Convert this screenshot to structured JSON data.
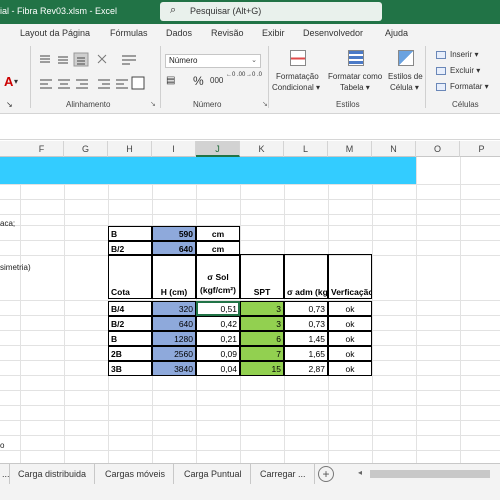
{
  "window": {
    "title": "ial - Fibra Rev03.xlsm  -  Excel"
  },
  "search": {
    "placeholder": "Pesquisar (Alt+G)"
  },
  "menu": [
    "Layout da Página",
    "Fórmulas",
    "Dados",
    "Revisão",
    "Exibir",
    "Desenvolvedor",
    "Ajuda"
  ],
  "ribbon": {
    "font_color_letter": "A",
    "font_color_arrow": "▾",
    "align_launcher": "↘",
    "number_format": "Número",
    "percent": "%",
    "thousands": "000",
    "decimals_inc": "←0 .00",
    "decimals_dec": "→0 .0",
    "conditional": [
      "Formatação",
      "Condicional ▾"
    ],
    "format_as_table": [
      "Formatar como",
      "Tabela ▾"
    ],
    "cell_styles": [
      "Estilos de",
      "Célula ▾"
    ],
    "insert": "Inserir ▾",
    "delete": "Excluir ▾",
    "format": "Formatar ▾",
    "groups": {
      "alignment": "Alinhamento",
      "number": "Número",
      "styles": "Estilos",
      "cells": "Células"
    }
  },
  "columns": [
    "F",
    "G",
    "H",
    "I",
    "J",
    "K",
    "L",
    "M",
    "N",
    "O",
    "P"
  ],
  "stray_text": [
    "aca;",
    "simetria)",
    "o"
  ],
  "top_table": [
    {
      "label": "B",
      "value": "590",
      "unit": "cm"
    },
    {
      "label": "B/2",
      "value": "640",
      "unit": "cm"
    }
  ],
  "main_table": {
    "headers": [
      "Cota",
      "H (cm)",
      "σ Sol\n(kgf/cm²)",
      "SPT",
      "σ adm (kg",
      "Verficação"
    ],
    "rows": [
      [
        "B/4",
        "320",
        "0,51",
        "3",
        "0,73",
        "ok"
      ],
      [
        "B/2",
        "640",
        "0,42",
        "3",
        "0,73",
        "ok"
      ],
      [
        "B",
        "1280",
        "0,21",
        "6",
        "1,45",
        "ok"
      ],
      [
        "2B",
        "2560",
        "0,09",
        "7",
        "1,65",
        "ok"
      ],
      [
        "3B",
        "3840",
        "0,04",
        "15",
        "2,87",
        "ok"
      ]
    ]
  },
  "sheet_tabs": [
    "...",
    "Carga distribuida",
    "Cargas móveis",
    "Carga Puntual",
    "Carregar ...",
    "+"
  ],
  "colors": {
    "excel_green": "#217346",
    "banner": "#33ccff",
    "blue_cell": "#8ea9db",
    "green_cell": "#92d050"
  }
}
